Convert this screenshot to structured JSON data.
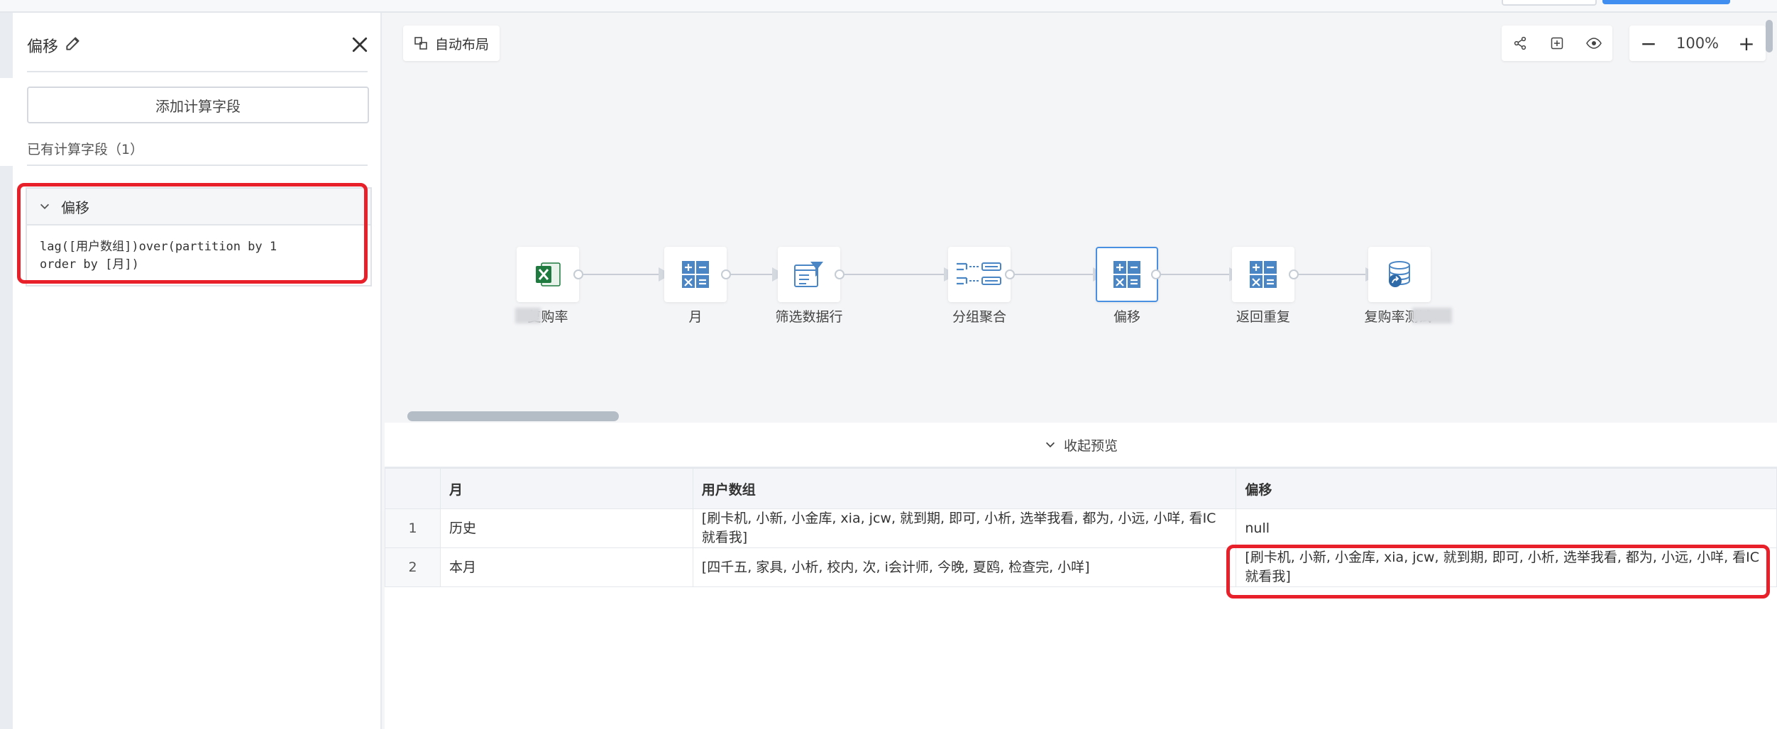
{
  "panel": {
    "title": "偏移",
    "add_button": "添加计算字段",
    "existing_label": "已有计算字段（1）",
    "field": {
      "name": "偏移",
      "formula": "lag([用户数组])over(partition by 1\norder by [月])"
    }
  },
  "canvas": {
    "auto_layout": "自动布局",
    "zoom_level": "100%",
    "zoom_out": "−",
    "zoom_in": "+",
    "nodes": [
      {
        "label": "复购率",
        "icon": "excel-icon"
      },
      {
        "label": "月",
        "icon": "calculator-icon"
      },
      {
        "label": "筛选数据行",
        "icon": "filter-icon"
      },
      {
        "label": "分组聚合",
        "icon": "group-aggregate-icon"
      },
      {
        "label": "偏移",
        "icon": "calculator-icon",
        "active": true
      },
      {
        "label": "返回重复",
        "icon": "calculator-icon"
      },
      {
        "label": "复购率测试",
        "icon": "database-icon"
      }
    ]
  },
  "preview": {
    "collapse_label": "收起预览",
    "columns": [
      "",
      "月",
      "用户数组",
      "偏移"
    ],
    "rows": [
      {
        "index": "1",
        "month": "历史",
        "users": "[刷卡机, 小新, 小金库, xia, jcw, 就到期, 即可, 小析, 选举我看, 都为, 小远, 小咩, 看IC就看我]",
        "offset": "null"
      },
      {
        "index": "2",
        "month": "本月",
        "users": "[四千五, 家具, 小析, 校内, 次, i会计师, 今晚, 夏鸥, 检查完, 小咩]",
        "offset": "[刷卡机, 小新, 小金库, xia, jcw, 就到期, 即可, 小析, 选举我看, 都为, 小远, 小咩, 看IC就看我]"
      }
    ]
  },
  "colors": {
    "accent": "#4a90e2",
    "highlight": "#e8202a",
    "excel": "#1e7a3f",
    "node_icon": "#4a86c5"
  }
}
